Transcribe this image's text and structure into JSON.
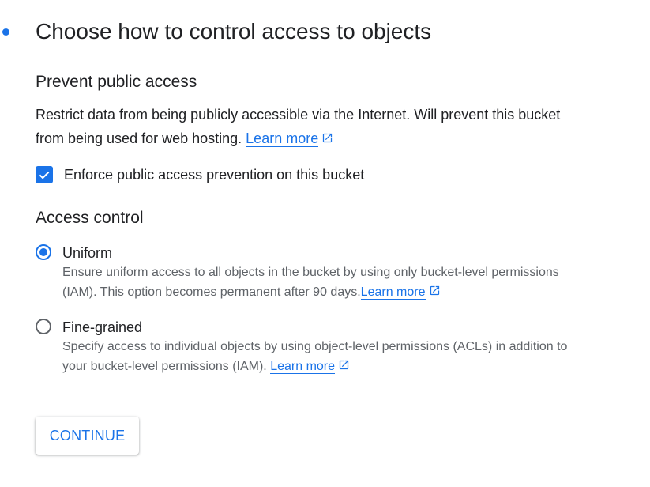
{
  "step": {
    "title": "Choose how to control access to objects"
  },
  "prevent_public_access": {
    "heading": "Prevent public access",
    "description": "Restrict data from being publicly accessible via the Internet. Will prevent this bucket from being used for web hosting.",
    "learn_more": "Learn more",
    "checkbox_label": "Enforce public access prevention on this bucket",
    "checkbox_checked": true
  },
  "access_control": {
    "heading": "Access control",
    "options": [
      {
        "title": "Uniform",
        "description": "Ensure uniform access to all objects in the bucket by using only bucket-level permissions (IAM). This option becomes permanent after 90 days.",
        "learn_more": "Learn more",
        "selected": true
      },
      {
        "title": "Fine-grained",
        "description": "Specify access to individual objects by using object-level permissions (ACLs) in addition to your bucket-level permissions (IAM).",
        "learn_more": "Learn more",
        "selected": false
      }
    ]
  },
  "continue_button": {
    "label": "CONTINUE"
  },
  "colors": {
    "accent": "#1a73e8",
    "text": "#202124",
    "secondary_text": "#5f6368"
  },
  "icons": {
    "step_indicator": "step-dot-icon",
    "external_link": "external-link-icon",
    "checkbox": "checkmark-icon",
    "radio": "radio-icon"
  }
}
